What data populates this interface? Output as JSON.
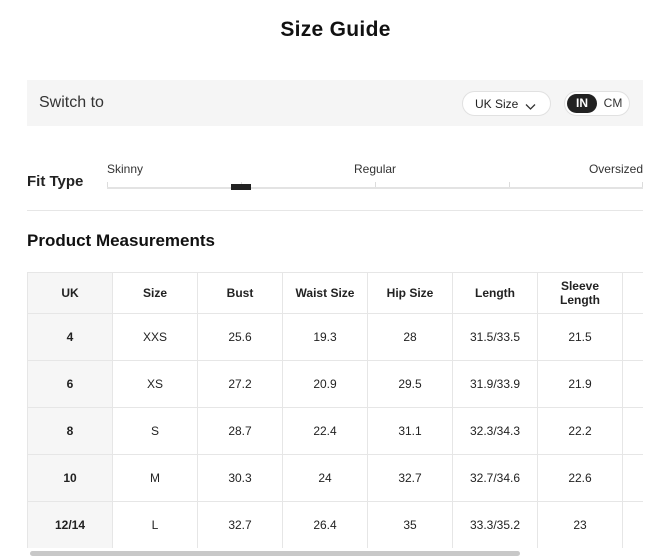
{
  "page": {
    "title": "Size Guide"
  },
  "switch": {
    "label": "Switch to",
    "size_select": {
      "value": "UK Size",
      "icon": "chevron-down-icon"
    },
    "units": {
      "in": "IN",
      "cm": "CM",
      "selected": "IN"
    }
  },
  "fit": {
    "label": "Fit Type",
    "scale": [
      "Skinny",
      "Regular",
      "Oversized"
    ],
    "value": 0.25
  },
  "measurements": {
    "title": "Product Measurements",
    "headers": [
      "UK",
      "Size",
      "Bust",
      "Waist Size",
      "Hip Size",
      "Length",
      "Sleeve Length",
      ""
    ],
    "rows": [
      [
        "4",
        "XXS",
        "25.6",
        "19.3",
        "28",
        "31.5/33.5",
        "21.5",
        ""
      ],
      [
        "6",
        "XS",
        "27.2",
        "20.9",
        "29.5",
        "31.9/33.9",
        "21.9",
        ""
      ],
      [
        "8",
        "S",
        "28.7",
        "22.4",
        "31.1",
        "32.3/34.3",
        "22.2",
        ""
      ],
      [
        "10",
        "M",
        "30.3",
        "24",
        "32.7",
        "32.7/34.6",
        "22.6",
        ""
      ],
      [
        "12/14",
        "L",
        "32.7",
        "26.4",
        "35",
        "33.3/35.2",
        "23",
        ""
      ]
    ]
  }
}
